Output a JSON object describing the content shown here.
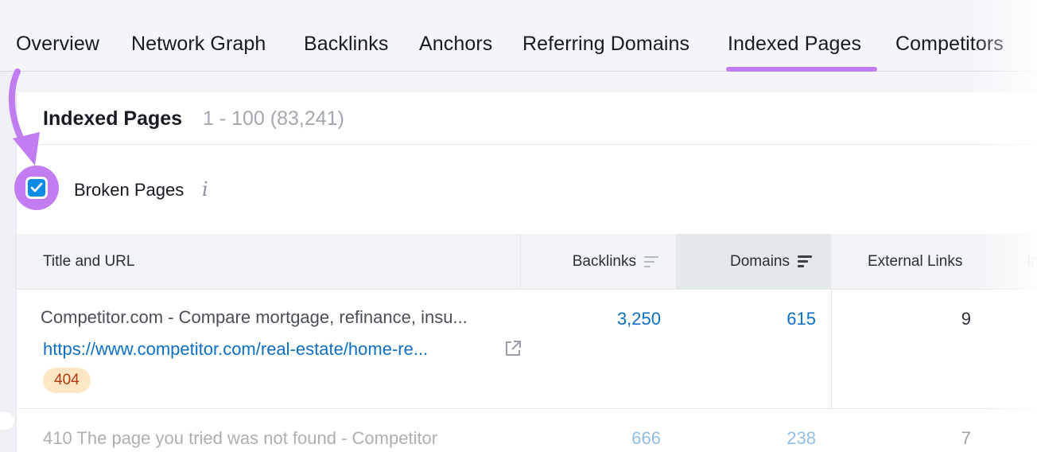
{
  "tabs": [
    {
      "label": "Overview",
      "active": false
    },
    {
      "label": "Network Graph",
      "active": false
    },
    {
      "label": "Backlinks",
      "active": false
    },
    {
      "label": "Anchors",
      "active": false
    },
    {
      "label": "Referring Domains",
      "active": false
    },
    {
      "label": "Indexed Pages",
      "active": true
    },
    {
      "label": "Competitors",
      "active": false
    }
  ],
  "panel": {
    "title": "Indexed Pages",
    "range": "1 - 100 (83,241)"
  },
  "filter": {
    "label": "Broken Pages",
    "checked": true,
    "info_icon": "info-icon"
  },
  "table": {
    "columns": {
      "title": "Title and URL",
      "backlinks": "Backlinks",
      "domains": "Domains",
      "external": "External Links",
      "more": "In"
    },
    "rows": [
      {
        "title": "Competitor.com - Compare mortgage, refinance, insu...",
        "url": "https://www.competitor.com/real-estate/home-re...",
        "status": "404",
        "backlinks": "3,250",
        "domains": "615",
        "external": "9"
      },
      {
        "title": "410 The page you tried was not found - Competitor",
        "backlinks": "666",
        "domains": "238",
        "external": "7"
      }
    ]
  },
  "colors": {
    "accent_purple": "#c27cf2",
    "link_blue": "#0d6fc4",
    "checkbox_blue": "#0a8ce6",
    "badge_bg": "#fde6c4",
    "badge_text": "#b23a10"
  }
}
